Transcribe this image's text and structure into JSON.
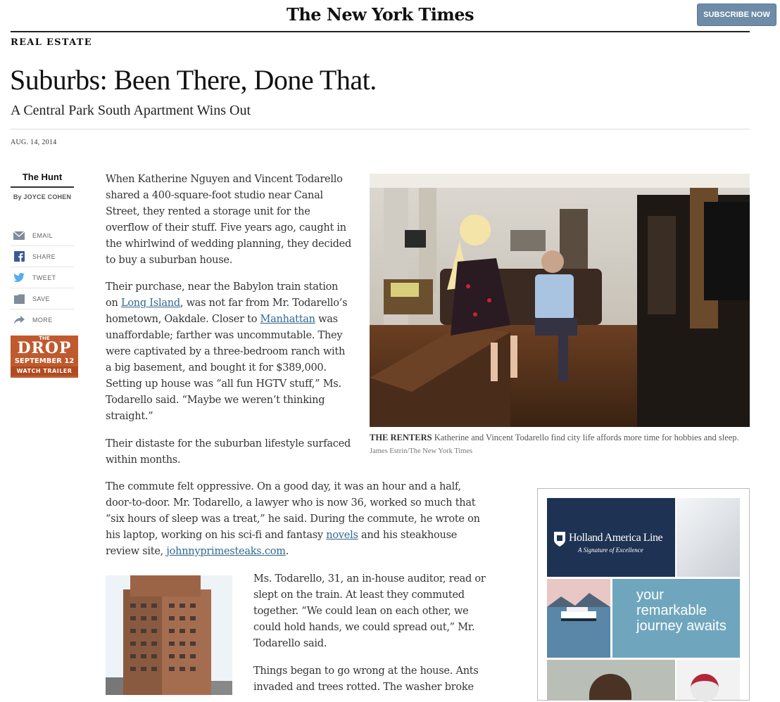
{
  "masthead": {
    "logo": "The New York Times",
    "subscribe_label": "SUBSCRIBE NOW"
  },
  "article": {
    "section": "REAL ESTATE",
    "headline": "Suburbs: Been There, Done That.",
    "subheadline": "A Central Park South Apartment Wins Out",
    "date": "AUG. 14, 2014",
    "column_name": "The Hunt",
    "byline": "By JOYCE COHEN",
    "paragraphs": {
      "p1": "When Katherine Nguyen and Vincent Todarello shared a 400-square-foot studio near Canal Street, they rented a storage unit for the overflow of their stuff. Five years ago, caught in the whirlwind of wedding planning, they decided to buy a suburban house.",
      "p2a": "Their purchase, near the Babylon train station on ",
      "p2_link1": "Long Island",
      "p2b": ", was not far from Mr. Todarello’s hometown, Oakdale. Closer to ",
      "p2_link2": "Manhattan",
      "p2c": " was unaffordable; farther was uncommutable. They were captivated by a three-bedroom ranch with a big basement, and bought it for $389,000. Setting up house was “all fun HGTV stuff,” Ms. Todarello said. “Maybe we weren’t thinking straight.”",
      "p3": "Their distaste for the suburban lifestyle surfaced within months.",
      "p4a": "The commute felt oppressive. On a good day, it was an hour and a half, door-to-door. Mr. Todarello, a lawyer who is now 36, worked so much that “six hours of sleep was a treat,” he said. During the commute, he wrote on his laptop, working on his sci-fi and fantasy ",
      "p4_link1": "novels",
      "p4b": " and his steakhouse review site, ",
      "p4_link2": "johnnyprimesteaks.com",
      "p4c": ".",
      "p5": "Ms. Todarello, 31, an in-house auditor, read or slept on the train. At least they commuted together. “We could lean on each other, we could hold hands, we could spread out,” Mr. Todarello said.",
      "p6": "Things began to go wrong at the house. Ants invaded and trees rotted. The washer broke"
    },
    "caption": {
      "lead": "THE RENTERS",
      "text": " Katherine and Vincent Todarello find city life affords more time for hobbies and sleep.",
      "credit": "James Estrin/The New York Times"
    }
  },
  "share_tools": [
    {
      "label": "EMAIL",
      "icon": "email-icon"
    },
    {
      "label": "SHARE",
      "icon": "facebook-icon"
    },
    {
      "label": "TWEET",
      "icon": "twitter-icon"
    },
    {
      "label": "SAVE",
      "icon": "save-folder-icon"
    },
    {
      "label": "MORE",
      "icon": "share-arrow-icon"
    }
  ],
  "promo": {
    "line1": "THE",
    "title": "DROP",
    "date": "SEPTEMBER 12",
    "cta": "WATCH TRAILER"
  },
  "ad": {
    "brand": "Holland America Line",
    "tagline": "A Signature of Excellence",
    "headline": "your remarkable journey awaits"
  },
  "colors": {
    "link": "#326891",
    "subscribe": "#6e8ba8",
    "promo": "#bf5a2e",
    "ad_navy": "#1e3253",
    "ad_teal": "#6fa6bd"
  }
}
